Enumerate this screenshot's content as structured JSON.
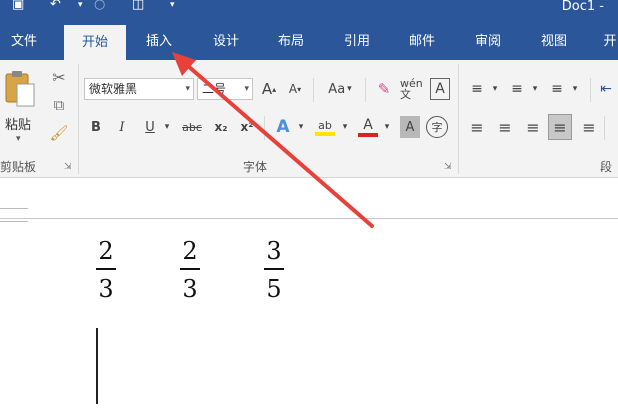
{
  "window": {
    "title": "Doc1 -"
  },
  "tabs": [
    {
      "label": "文件"
    },
    {
      "label": "开始"
    },
    {
      "label": "插入"
    },
    {
      "label": "设计"
    },
    {
      "label": "布局"
    },
    {
      "label": "引用"
    },
    {
      "label": "邮件"
    },
    {
      "label": "审阅"
    },
    {
      "label": "视图"
    },
    {
      "label": "开"
    }
  ],
  "active_tab": "开始",
  "clipboard": {
    "paste_label": "粘贴",
    "group_label": "剪贴板"
  },
  "font": {
    "font_name": "微软雅黑",
    "font_size": "二号",
    "grow_label": "A",
    "shrink_label": "A",
    "case_label": "Aa",
    "phonetic_label": "wén文",
    "border_label": "A",
    "bold_label": "B",
    "italic_label": "I",
    "underline_label": "U",
    "strike_label": "abc",
    "sub_label": "x₂",
    "sup_label": "x²",
    "effects_label": "A",
    "highlight_label": "ab",
    "color_label": "A",
    "shading_label": "A",
    "enclose_label": "字",
    "group_label": "字体"
  },
  "paragraph": {
    "group_label": "段"
  },
  "colors": {
    "ribbon_blue": "#2b579a",
    "arrow_red": "#e8413a",
    "highlight_yellow": "#ffe500",
    "font_red": "#e02020"
  },
  "document": {
    "fractions": [
      {
        "numerator": "2",
        "denominator": "3"
      },
      {
        "numerator": "2",
        "denominator": "3"
      },
      {
        "numerator": "3",
        "denominator": "5"
      }
    ]
  }
}
